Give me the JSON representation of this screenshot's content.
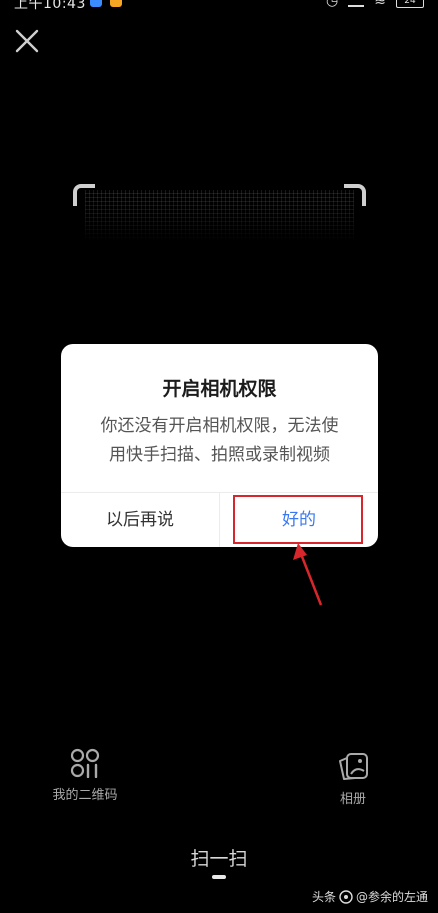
{
  "status_bar": {
    "time": "上午10:43",
    "battery": "24"
  },
  "dialog": {
    "title": "开启相机权限",
    "message_line1": "你还没有开启相机权限，无法使",
    "message_line2": "用快手扫描、拍照或录制视频",
    "btn_later": "以后再说",
    "btn_ok": "好的"
  },
  "tools": {
    "my_qr": "我的二维码",
    "album": "相册"
  },
  "mode": {
    "label": "扫一扫"
  },
  "watermark": {
    "prefix": "头条",
    "author": "@参余的左通"
  },
  "colors": {
    "background": "#000000",
    "dialog_bg": "#ffffff",
    "accent_blue": "#3a78f2",
    "highlight_red": "#d7262c"
  }
}
